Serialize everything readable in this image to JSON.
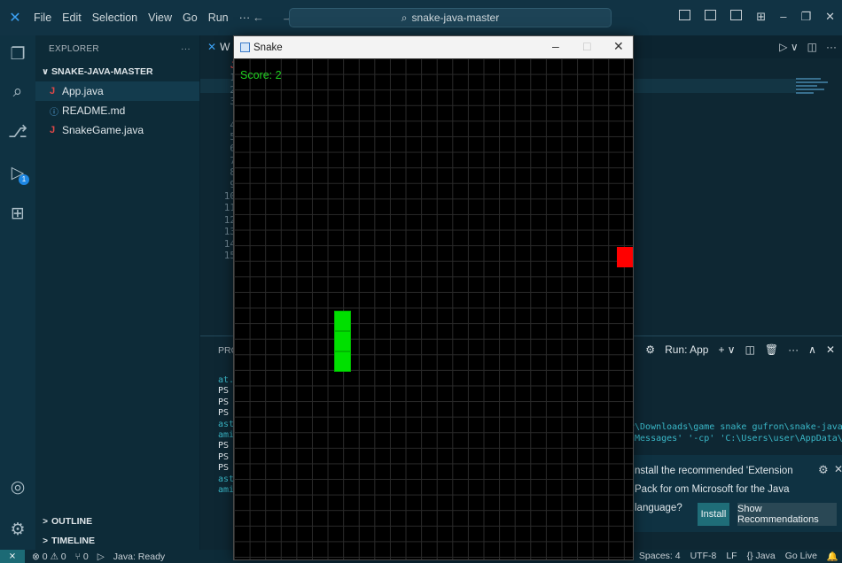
{
  "titlebar": {
    "menu": [
      "File",
      "Edit",
      "Selection",
      "View",
      "Go",
      "Run",
      "···"
    ],
    "nav": "← →",
    "search": "snake-java-master"
  },
  "sidebar": {
    "title": "EXPLORER",
    "more": "···",
    "section": "SNAKE-JAVA-MASTER",
    "files": [
      {
        "name": "App.java",
        "type": "java"
      },
      {
        "name": "README.md",
        "type": "info"
      },
      {
        "name": "SnakeGame.java",
        "type": "java"
      }
    ],
    "outline": "OUTLINE",
    "timeline": "TIMELINE"
  },
  "editor": {
    "tab_label": "W",
    "line_numbers": [
      "1",
      "2",
      "3",
      "",
      "4",
      "5",
      "6",
      "7",
      "8",
      "9",
      "10",
      "11",
      "12",
      "13",
      "14",
      "15"
    ]
  },
  "panel": {
    "tab_label": "PRO",
    "run_label": "Run: App",
    "terminal_left": [
      "at.",
      "PS",
      "PS",
      "PS",
      "ast",
      "ami",
      "PS",
      "PS",
      "PS",
      "ast",
      "ami"
    ],
    "terminal_right": [
      "r\\Downloads\\game snake gufron\\snake-java-m",
      "nMessages' '-cp' 'C:\\Users\\user\\AppData\\Ro"
    ]
  },
  "notification": {
    "text": "nstall the recommended 'Extension Pack for om Microsoft for the Java language?",
    "install": "Install",
    "recommend": "Show Recommendations"
  },
  "statusbar": {
    "errors": "⊗ 0 ⚠ 0",
    "ports": "⑂ 0",
    "java": "Java: Ready",
    "position": "ol 1",
    "spaces": "Spaces: 4",
    "encoding": "UTF-8",
    "eol": "LF",
    "language": "{} Java",
    "golive": "Go Live"
  },
  "snake_window": {
    "title": "Snake",
    "score": "Score: 2"
  },
  "colors": {
    "snake": "#00e000",
    "food": "#ff0000",
    "score": "#1fd11f",
    "accent": "#1e88e5"
  }
}
